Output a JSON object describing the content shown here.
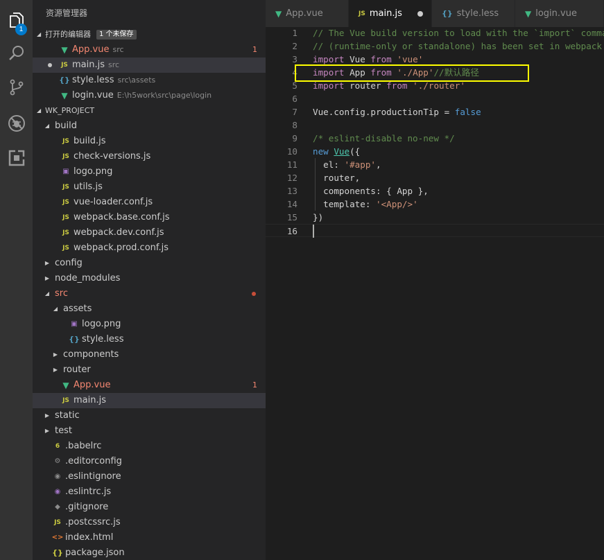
{
  "activity": {
    "items": [
      {
        "name": "explorer-icon",
        "badge": "1"
      },
      {
        "name": "search-icon"
      },
      {
        "name": "source-control-icon"
      },
      {
        "name": "debug-icon"
      },
      {
        "name": "extensions-icon"
      }
    ]
  },
  "sidebar": {
    "title": "资源管理器",
    "open_editors": {
      "label": "打开的编辑器",
      "unsaved": "1 个未保存",
      "items": [
        {
          "icon": "vue",
          "name": "App.vue",
          "desc": "src",
          "count": "1",
          "error": true
        },
        {
          "icon": "js",
          "name": "main.js",
          "desc": "src",
          "modified": true
        },
        {
          "icon": "less",
          "name": "style.less",
          "desc": "src\\assets"
        },
        {
          "icon": "vue",
          "name": "login.vue",
          "desc": "E:\\h5work\\src\\page\\login"
        }
      ]
    },
    "project": {
      "label": "WK_PROJECT",
      "tree": [
        {
          "depth": 1,
          "type": "folder",
          "open": true,
          "name": "build"
        },
        {
          "depth": 2,
          "icon": "js",
          "name": "build.js"
        },
        {
          "depth": 2,
          "icon": "js",
          "name": "check-versions.js"
        },
        {
          "depth": 2,
          "icon": "png",
          "name": "logo.png"
        },
        {
          "depth": 2,
          "icon": "js",
          "name": "utils.js"
        },
        {
          "depth": 2,
          "icon": "js",
          "name": "vue-loader.conf.js"
        },
        {
          "depth": 2,
          "icon": "js",
          "name": "webpack.base.conf.js"
        },
        {
          "depth": 2,
          "icon": "js",
          "name": "webpack.dev.conf.js"
        },
        {
          "depth": 2,
          "icon": "js",
          "name": "webpack.prod.conf.js"
        },
        {
          "depth": 1,
          "type": "folder",
          "open": false,
          "name": "config"
        },
        {
          "depth": 1,
          "type": "folder",
          "open": false,
          "name": "node_modules"
        },
        {
          "depth": 1,
          "type": "folder",
          "open": true,
          "name": "src",
          "error": true,
          "dot": true
        },
        {
          "depth": 2,
          "type": "folder",
          "open": true,
          "name": "assets"
        },
        {
          "depth": 3,
          "icon": "png",
          "name": "logo.png"
        },
        {
          "depth": 3,
          "icon": "less",
          "name": "style.less"
        },
        {
          "depth": 2,
          "type": "folder",
          "open": false,
          "name": "components"
        },
        {
          "depth": 2,
          "type": "folder",
          "open": false,
          "name": "router"
        },
        {
          "depth": 2,
          "icon": "vue",
          "name": "App.vue",
          "error": true,
          "count": "1"
        },
        {
          "depth": 2,
          "icon": "js",
          "name": "main.js",
          "selected": true
        },
        {
          "depth": 1,
          "type": "folder",
          "open": false,
          "name": "static"
        },
        {
          "depth": 1,
          "type": "folder",
          "open": false,
          "name": "test"
        },
        {
          "depth": 1,
          "icon": "babel",
          "name": ".babelrc"
        },
        {
          "depth": 1,
          "icon": "gear",
          "name": ".editorconfig"
        },
        {
          "depth": 1,
          "icon": "eslintignore",
          "name": ".eslintignore"
        },
        {
          "depth": 1,
          "icon": "eslint",
          "name": ".eslintrc.js"
        },
        {
          "depth": 1,
          "icon": "git",
          "name": ".gitignore"
        },
        {
          "depth": 1,
          "icon": "js",
          "name": ".postcssrc.js"
        },
        {
          "depth": 1,
          "icon": "html",
          "name": "index.html"
        },
        {
          "depth": 1,
          "icon": "json",
          "name": "package.json"
        }
      ]
    }
  },
  "tabs": [
    {
      "icon": "vue",
      "name": "App.vue",
      "active": false
    },
    {
      "icon": "js",
      "name": "main.js",
      "active": true,
      "modified": true
    },
    {
      "icon": "less",
      "name": "style.less",
      "active": false
    },
    {
      "icon": "vue",
      "name": "login.vue",
      "active": false
    }
  ],
  "code": {
    "current_line": 16,
    "lines": [
      [
        [
          "cm",
          "// The Vue build version to load with the `import` command"
        ]
      ],
      [
        [
          "cm",
          "// (runtime-only or standalone) has been set in webpack.base.conf with an alias."
        ]
      ],
      [
        [
          "kw",
          "import"
        ],
        [
          "plain",
          " Vue "
        ],
        [
          "kw",
          "from"
        ],
        [
          "plain",
          " "
        ],
        [
          "str",
          "'vue'"
        ]
      ],
      [
        [
          "kw",
          "import"
        ],
        [
          "plain",
          " App "
        ],
        [
          "kw",
          "from"
        ],
        [
          "plain",
          " "
        ],
        [
          "str",
          "'./App'"
        ],
        [
          "cm",
          "//默认路径"
        ]
      ],
      [
        [
          "kw",
          "import"
        ],
        [
          "plain",
          " router "
        ],
        [
          "kw",
          "from"
        ],
        [
          "plain",
          " "
        ],
        [
          "str",
          "'./router'"
        ]
      ],
      [],
      [
        [
          "plain",
          "Vue.config.productionTip "
        ],
        [
          "plain",
          "="
        ],
        [
          "plain",
          " "
        ],
        [
          "kb",
          "false"
        ]
      ],
      [],
      [
        [
          "cm",
          "/* eslint-disable no-new */"
        ]
      ],
      [
        [
          "kb",
          "new"
        ],
        [
          "plain",
          " "
        ],
        [
          "cls",
          "Vue"
        ],
        [
          "plain",
          "({"
        ]
      ],
      [
        [
          "plain",
          "  el: "
        ],
        [
          "str",
          "'#app'"
        ],
        [
          "plain",
          ","
        ]
      ],
      [
        [
          "plain",
          "  router,"
        ]
      ],
      [
        [
          "plain",
          "  components: { App },"
        ]
      ],
      [
        [
          "plain",
          "  template: "
        ],
        [
          "str",
          "'<App/>'"
        ]
      ],
      [
        [
          "plain",
          "})"
        ]
      ],
      []
    ]
  },
  "colors": {
    "highlight_box": "#ffff00",
    "accent": "#007acc"
  }
}
